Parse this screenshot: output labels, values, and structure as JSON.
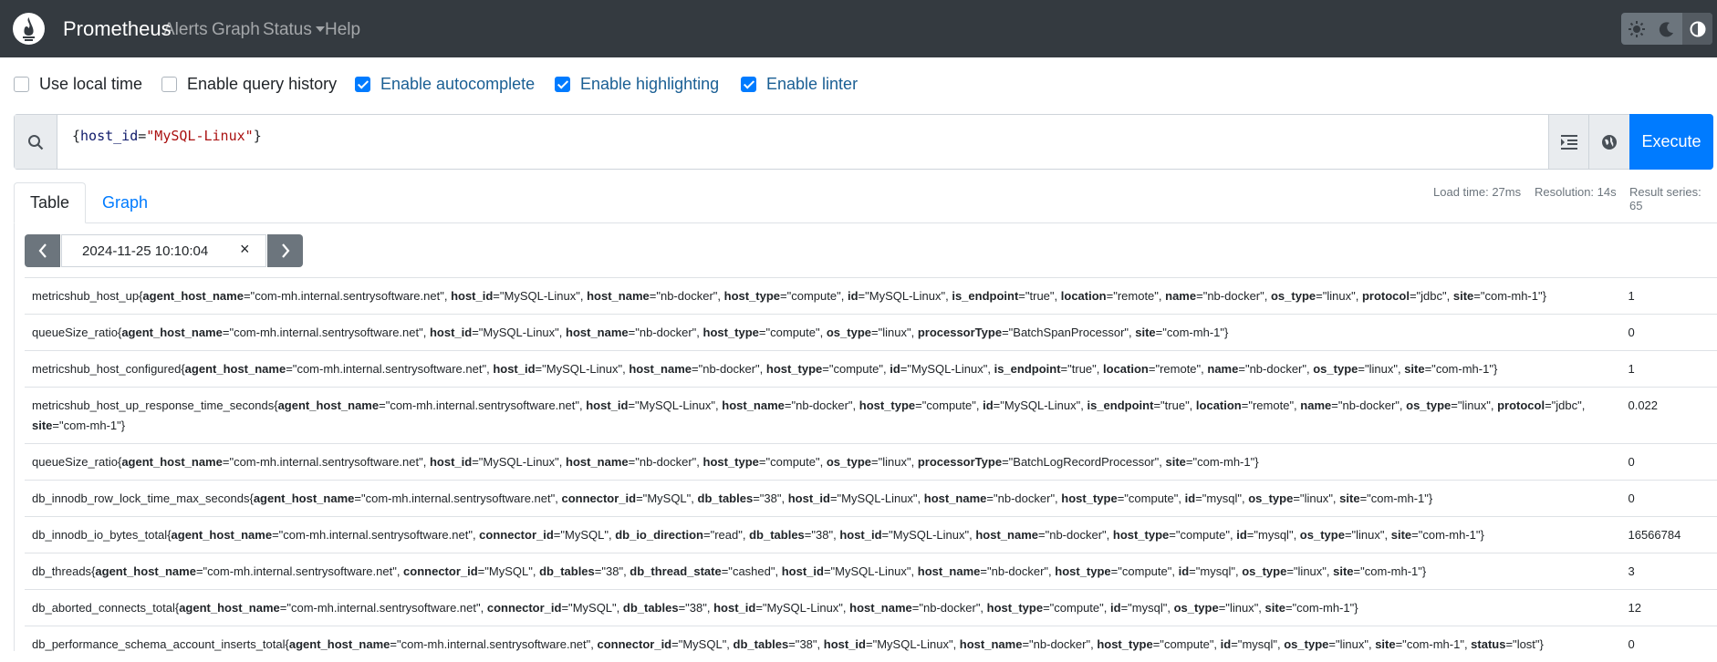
{
  "nav": {
    "brand": "Prometheus",
    "links": [
      {
        "label": "Alerts"
      },
      {
        "label": "Graph"
      },
      {
        "label": "Status"
      },
      {
        "label": "Help"
      }
    ],
    "theme_buttons": [
      "sun-icon",
      "moon-icon",
      "contrast-icon"
    ]
  },
  "options": [
    {
      "label": "Use local time",
      "checked": false
    },
    {
      "label": "Enable query history",
      "checked": false
    },
    {
      "label": "Enable autocomplete",
      "checked": true
    },
    {
      "label": "Enable highlighting",
      "checked": true
    },
    {
      "label": "Enable linter",
      "checked": true
    }
  ],
  "query": {
    "open": "{",
    "key": "host_id",
    "eq": "=",
    "value": "\"MySQL-Linux\"",
    "close": "}",
    "execute_label": "Execute"
  },
  "tabs": {
    "table": "Table",
    "graph": "Graph"
  },
  "stats": {
    "load_time": "Load time: 27ms",
    "resolution": "Resolution: 14s",
    "result_series": "Result series: 65"
  },
  "datetime": {
    "value": "2024-11-25 10:10:04",
    "clear": "×"
  },
  "colors": {
    "navbar": "#343a40",
    "accent": "#007bff",
    "link": "#1a5f94"
  },
  "rows": [
    {
      "metric": "metricshub_host_up",
      "labels": [
        [
          "agent_host_name",
          "com-mh.internal.sentrysoftware.net"
        ],
        [
          "host_id",
          "MySQL-Linux"
        ],
        [
          "host_name",
          "nb-docker"
        ],
        [
          "host_type",
          "compute"
        ],
        [
          "id",
          "MySQL-Linux"
        ],
        [
          "is_endpoint",
          "true"
        ],
        [
          "location",
          "remote"
        ],
        [
          "name",
          "nb-docker"
        ],
        [
          "os_type",
          "linux"
        ],
        [
          "protocol",
          "jdbc"
        ],
        [
          "site",
          "com-mh-1"
        ]
      ],
      "value": "1"
    },
    {
      "metric": "queueSize_ratio",
      "labels": [
        [
          "agent_host_name",
          "com-mh.internal.sentrysoftware.net"
        ],
        [
          "host_id",
          "MySQL-Linux"
        ],
        [
          "host_name",
          "nb-docker"
        ],
        [
          "host_type",
          "compute"
        ],
        [
          "os_type",
          "linux"
        ],
        [
          "processorType",
          "BatchSpanProcessor"
        ],
        [
          "site",
          "com-mh-1"
        ]
      ],
      "value": "0"
    },
    {
      "metric": "metricshub_host_configured",
      "labels": [
        [
          "agent_host_name",
          "com-mh.internal.sentrysoftware.net"
        ],
        [
          "host_id",
          "MySQL-Linux"
        ],
        [
          "host_name",
          "nb-docker"
        ],
        [
          "host_type",
          "compute"
        ],
        [
          "id",
          "MySQL-Linux"
        ],
        [
          "is_endpoint",
          "true"
        ],
        [
          "location",
          "remote"
        ],
        [
          "name",
          "nb-docker"
        ],
        [
          "os_type",
          "linux"
        ],
        [
          "site",
          "com-mh-1"
        ]
      ],
      "value": "1"
    },
    {
      "metric": "metricshub_host_up_response_time_seconds",
      "labels": [
        [
          "agent_host_name",
          "com-mh.internal.sentrysoftware.net"
        ],
        [
          "host_id",
          "MySQL-Linux"
        ],
        [
          "host_name",
          "nb-docker"
        ],
        [
          "host_type",
          "compute"
        ],
        [
          "id",
          "MySQL-Linux"
        ],
        [
          "is_endpoint",
          "true"
        ],
        [
          "location",
          "remote"
        ],
        [
          "name",
          "nb-docker"
        ],
        [
          "os_type",
          "linux"
        ],
        [
          "protocol",
          "jdbc"
        ],
        [
          "site",
          "com-mh-1"
        ]
      ],
      "value": "0.022"
    },
    {
      "metric": "queueSize_ratio",
      "labels": [
        [
          "agent_host_name",
          "com-mh.internal.sentrysoftware.net"
        ],
        [
          "host_id",
          "MySQL-Linux"
        ],
        [
          "host_name",
          "nb-docker"
        ],
        [
          "host_type",
          "compute"
        ],
        [
          "os_type",
          "linux"
        ],
        [
          "processorType",
          "BatchLogRecordProcessor"
        ],
        [
          "site",
          "com-mh-1"
        ]
      ],
      "value": "0"
    },
    {
      "metric": "db_innodb_row_lock_time_max_seconds",
      "labels": [
        [
          "agent_host_name",
          "com-mh.internal.sentrysoftware.net"
        ],
        [
          "connector_id",
          "MySQL"
        ],
        [
          "db_tables",
          "38"
        ],
        [
          "host_id",
          "MySQL-Linux"
        ],
        [
          "host_name",
          "nb-docker"
        ],
        [
          "host_type",
          "compute"
        ],
        [
          "id",
          "mysql"
        ],
        [
          "os_type",
          "linux"
        ],
        [
          "site",
          "com-mh-1"
        ]
      ],
      "value": "0"
    },
    {
      "metric": "db_innodb_io_bytes_total",
      "labels": [
        [
          "agent_host_name",
          "com-mh.internal.sentrysoftware.net"
        ],
        [
          "connector_id",
          "MySQL"
        ],
        [
          "db_io_direction",
          "read"
        ],
        [
          "db_tables",
          "38"
        ],
        [
          "host_id",
          "MySQL-Linux"
        ],
        [
          "host_name",
          "nb-docker"
        ],
        [
          "host_type",
          "compute"
        ],
        [
          "id",
          "mysql"
        ],
        [
          "os_type",
          "linux"
        ],
        [
          "site",
          "com-mh-1"
        ]
      ],
      "value": "16566784"
    },
    {
      "metric": "db_threads",
      "labels": [
        [
          "agent_host_name",
          "com-mh.internal.sentrysoftware.net"
        ],
        [
          "connector_id",
          "MySQL"
        ],
        [
          "db_tables",
          "38"
        ],
        [
          "db_thread_state",
          "cashed"
        ],
        [
          "host_id",
          "MySQL-Linux"
        ],
        [
          "host_name",
          "nb-docker"
        ],
        [
          "host_type",
          "compute"
        ],
        [
          "id",
          "mysql"
        ],
        [
          "os_type",
          "linux"
        ],
        [
          "site",
          "com-mh-1"
        ]
      ],
      "value": "3"
    },
    {
      "metric": "db_aborted_connects_total",
      "labels": [
        [
          "agent_host_name",
          "com-mh.internal.sentrysoftware.net"
        ],
        [
          "connector_id",
          "MySQL"
        ],
        [
          "db_tables",
          "38"
        ],
        [
          "host_id",
          "MySQL-Linux"
        ],
        [
          "host_name",
          "nb-docker"
        ],
        [
          "host_type",
          "compute"
        ],
        [
          "id",
          "mysql"
        ],
        [
          "os_type",
          "linux"
        ],
        [
          "site",
          "com-mh-1"
        ]
      ],
      "value": "12"
    },
    {
      "metric": "db_performance_schema_account_inserts_total",
      "labels": [
        [
          "agent_host_name",
          "com-mh.internal.sentrysoftware.net"
        ],
        [
          "connector_id",
          "MySQL"
        ],
        [
          "db_tables",
          "38"
        ],
        [
          "host_id",
          "MySQL-Linux"
        ],
        [
          "host_name",
          "nb-docker"
        ],
        [
          "host_type",
          "compute"
        ],
        [
          "id",
          "mysql"
        ],
        [
          "os_type",
          "linux"
        ],
        [
          "site",
          "com-mh-1"
        ],
        [
          "status",
          "lost"
        ]
      ],
      "value": "0"
    }
  ]
}
